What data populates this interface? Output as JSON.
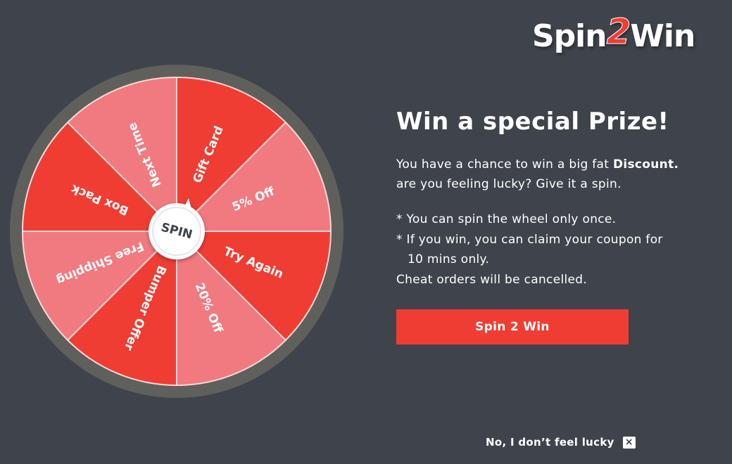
{
  "colors": {
    "background": "#3f444c",
    "accent": "#ef3d33",
    "segment_dark": "#ef3d33",
    "segment_light": "#f07a7f",
    "rim": "#5f605c"
  },
  "logo": {
    "part1": "Spin",
    "part2": "2",
    "part3": "Win"
  },
  "wheel": {
    "center_label": "SPIN",
    "segments": [
      {
        "label": "Gift Card",
        "shade": "dark"
      },
      {
        "label": "5% Off",
        "shade": "light"
      },
      {
        "label": "Try Again",
        "shade": "dark"
      },
      {
        "label": "20% Off",
        "shade": "light"
      },
      {
        "label": "Bumper Offer",
        "shade": "dark"
      },
      {
        "label": "Free Shipping",
        "shade": "light"
      },
      {
        "label": "Box Pack",
        "shade": "dark"
      },
      {
        "label": "Next Time",
        "shade": "light"
      }
    ]
  },
  "panel": {
    "headline": "Win a special Prize!",
    "intro_text": "You have a chance to win a big fat ",
    "intro_bold": "Discount.",
    "intro_line2": "are you feeling lucky? Give it a spin.",
    "rule1": "* You can spin the wheel only once.",
    "rule2": "* If you win, you can claim your coupon for",
    "rule2_cont": "10 mins only.",
    "rule3": "Cheat orders will be cancelled."
  },
  "spin_button": {
    "label": "Spin 2 Win"
  },
  "decline": {
    "label": "No, I don’t feel lucky",
    "close_icon": "×"
  }
}
